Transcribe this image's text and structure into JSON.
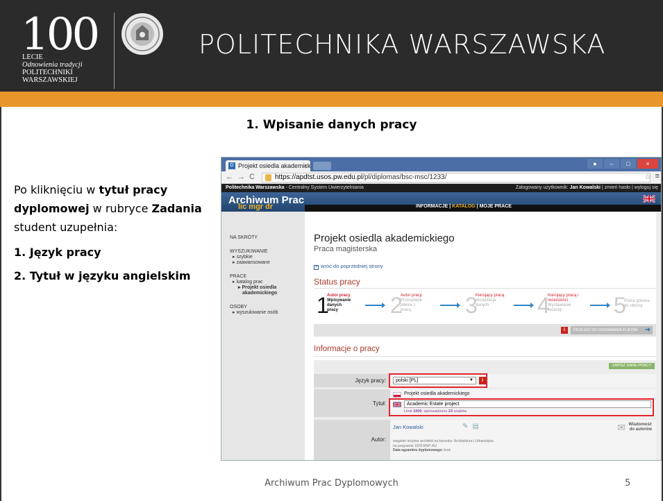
{
  "slide": {
    "org_name": "POLITECHNIKA WARSZAWSKA",
    "logo": {
      "digits": "100",
      "line1": "LECIE",
      "line2": "Odnowienia tradycji",
      "line3": "POLITECHNIKI",
      "line4": "WARSZAWSKIEJ"
    },
    "title": "1. Wpisanie danych pracy",
    "intro_1": "Po kliknięciu w ",
    "intro_bold_1": "tytuł pracy dyplomowej",
    "intro_2": " w rubryce ",
    "intro_bold_2": "Zadania",
    "intro_3": " student uzupełnia:",
    "steps": [
      "1.  Język pracy",
      "2.  Tytuł w języku angielskim"
    ],
    "footer": "Archiwum Prac Dyplomowych",
    "page_number": "5",
    "colors": {
      "header_bg": "#2b2b2b",
      "accent": "#e8962b",
      "highlight": "#e3232c"
    }
  },
  "browser": {
    "tab_title": "Projekt osiedla akademick",
    "tab_close": "×",
    "url_host": "https://apdtst.usos.pw.edu.pl",
    "url_path": "/pl/diplomas/bsc-msc/1233/",
    "win_min": "–",
    "win_max": "□",
    "win_close": "×"
  },
  "site": {
    "topbar_org": "Politechnika Warszawska",
    "topbar_rest": " - Centralny System Uwierzytelniania",
    "user_prefix": "Zalogowany użytkownik: ",
    "user_name": "Jan Kowalski",
    "user_links": " | zmień hasło | wyloguj się",
    "brand": "Archiwum Prac",
    "brand_sub": "lic mgr dr",
    "nav": [
      "INFORMACJE",
      "KATALOG",
      "MOJE PRACE"
    ],
    "sidebar": {
      "na_skroty": "NA SKRÓTY",
      "wyszukiwanie": "WYSZUKIWANIE",
      "szybkie": "▸ szybkie",
      "zaawansowane": "▸ zaawansowane",
      "prace": "PRACE",
      "katalog": "▸ katalog prac",
      "projekt1": "▸ Projekt osiedla",
      "projekt2": "akademickiego",
      "osoby": "OSOBY",
      "wyszukiwanie_osob": "▸ wyszukiwanie osób"
    },
    "main": {
      "title": "Projekt osiedla akademickiego",
      "subtitle": "Praca magisterska",
      "back_link": "wróć do poprzedniej strony",
      "status_header": "Status pracy",
      "steps": [
        {
          "num": "1",
          "role": "Autor pracy",
          "line1": "Wpisywanie",
          "line2": "danych",
          "line3": "pracy"
        },
        {
          "num": "2",
          "role": "Autor pracy",
          "line1": "Przesyłanie",
          "line2": "plików z",
          "line3": "pracą"
        },
        {
          "num": "3",
          "role": "Kierujący pracą",
          "line1": "Akceptacja",
          "line2": "danych",
          "line3": ""
        },
        {
          "num": "4",
          "role": "Kierujący pracą i",
          "role2": "recenzenci",
          "line1": "Wystawianie",
          "line2": "recenzji",
          "line3": ""
        },
        {
          "num": "5",
          "role": "",
          "line1": "Praca gotowa",
          "line2": "do obrony",
          "line3": ""
        }
      ],
      "proceed_label": "PRZEJDŹ DO DODAWANIA PLIKÓW",
      "info_header": "Informacje o pracy",
      "save_label": "ZAPISZ DANE PRACY",
      "lang_label": "Język pracy:",
      "lang_value": "polski [PL]",
      "title_label": "Tytuł:",
      "title_pl": "Projekt osiedla akademickiego",
      "title_en": "Academic Estate project",
      "limit_prefix": "Limit ",
      "limit_max": "1000",
      "limit_mid": ", wprowadzono ",
      "limit_count": "23",
      "limit_suffix": " znaków",
      "author_label": "Autor:",
      "author_name": "Jan Kowalski",
      "msg_line1": "Wiadomość",
      "msg_line2": "do autorów",
      "author_desc_1": "magister inżynier architekt na kierunku: Architektura i Urbanistyka",
      "author_desc_2": "na programie 1018-MSP-AU",
      "author_exam_label": "Data egzaminu dyplomowego:",
      "author_exam_value": " brak"
    }
  }
}
